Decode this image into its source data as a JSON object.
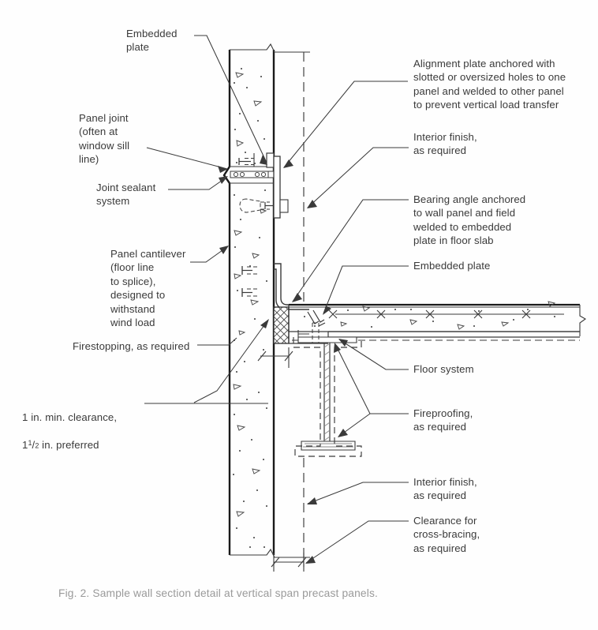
{
  "figure": {
    "caption": "Fig. 2. Sample wall section detail at vertical span precast panels.",
    "title": "Sample wall section detail at vertical span precast panels",
    "number": "Fig. 2",
    "drawing_type": "architectural-section-detail"
  },
  "colors": {
    "background": "#fefefe",
    "line": "#3a3a3a",
    "heavy_line": "#1a1a1a",
    "label_text": "#3a3a3a",
    "caption_text": "#9a9a9a",
    "hatch": "#555555"
  },
  "labels": {
    "embedded_plate_top": "Embedded\nplate",
    "panel_joint": "Panel joint\n(often at\nwindow sill\nline)",
    "joint_sealant": "Joint sealant\nsystem",
    "panel_cantilever": "Panel cantilever\n(floor line\nto splice),\ndesigned to\nwithstand\nwind load",
    "firestopping": "Firestopping, as required",
    "clearance_line1": "1 in. min. clearance,",
    "clearance_line2_pre": "1",
    "clearance_line2_num": "1",
    "clearance_line2_den": "2",
    "clearance_line2_post": " in. preferred",
    "alignment_plate": "Alignment plate anchored with\nslotted or oversized holes to one\npanel and welded to other panel\nto prevent vertical load transfer",
    "interior_finish_upper": "Interior finish,\nas required",
    "bearing_angle": "Bearing angle anchored\nto wall panel and field\nwelded to embedded\nplate in floor slab",
    "embedded_plate_right": "Embedded plate",
    "floor_system": "Floor system",
    "fireproofing": "Fireproofing,\nas required",
    "interior_finish_lower": "Interior finish,\nas required",
    "clearance_cross_bracing": "Clearance for\ncross-bracing,\nas required"
  },
  "components": [
    {
      "name": "precast-wall-panel",
      "description": "Vertical span precast concrete wall panel shown in section with stipple and aggregate hatching"
    },
    {
      "name": "panel-joint",
      "description": "Horizontal joint between upper and lower precast panels at window sill line"
    },
    {
      "name": "joint-sealant",
      "description": "Sealant and backer rod at panel joint"
    },
    {
      "name": "embedded-plate-panel",
      "description": "Steel plate embedded in precast panel with welded anchors"
    },
    {
      "name": "alignment-plate",
      "description": "Vertical alignment plate bridging the panel joint with slotted holes"
    },
    {
      "name": "bearing-angle",
      "description": "Steel bearing angle from wall panel to floor slab"
    },
    {
      "name": "embedded-plate-slab",
      "description": "Steel plate embedded in concrete floor slab with deformed bar anchors"
    },
    {
      "name": "floor-slab",
      "description": "Concrete floor slab over metal deck with welded wire reinforcement shown as X marks"
    },
    {
      "name": "metal-deck",
      "description": "Corrugated steel floor deck below slab"
    },
    {
      "name": "steel-beam",
      "description": "Steel wide-flange beam shown hidden below slab"
    },
    {
      "name": "fireproofing",
      "description": "Sprayed fireproofing envelope around steel beam, shown dashed"
    },
    {
      "name": "firestopping",
      "description": "Cross-hatched firestopping block between panel and slab edge"
    },
    {
      "name": "interior-finish",
      "description": "Interior finish line shown dashed inboard of wall panel"
    },
    {
      "name": "clearance-dimension",
      "description": "Dimension line for clearance between panel and slab edge"
    },
    {
      "name": "cross-bracing-clearance-dimension",
      "description": "Bottom dimension line for cross bracing clearance"
    }
  ]
}
